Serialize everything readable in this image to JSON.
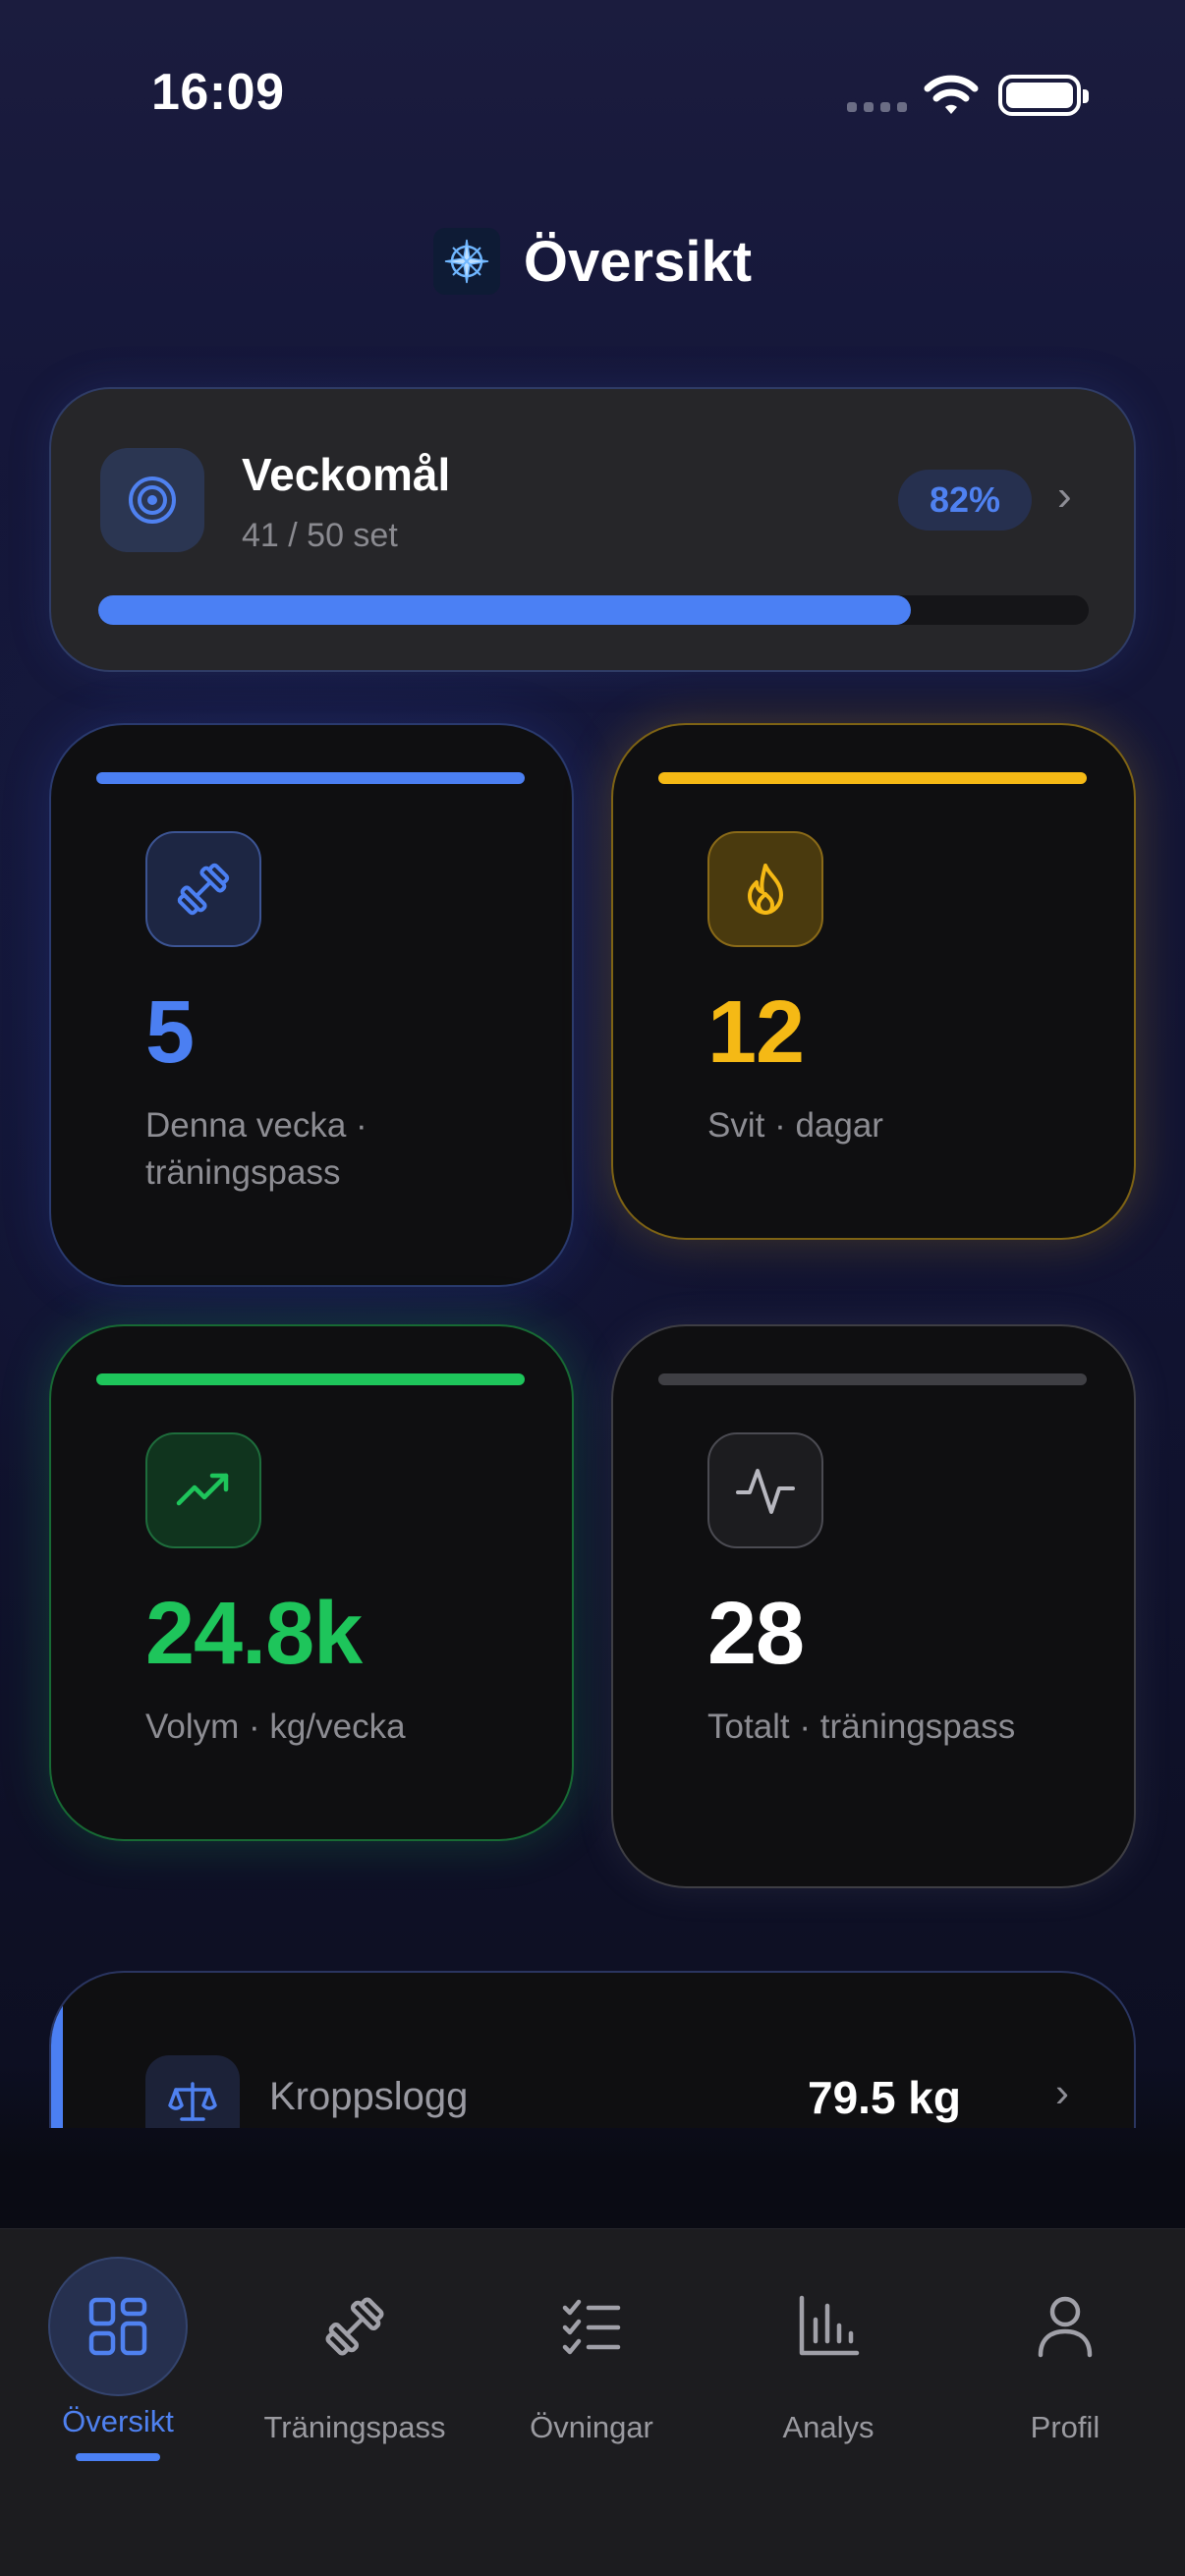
{
  "status_bar": {
    "time": "16:09"
  },
  "header": {
    "title": "Översikt",
    "logo_icon": "compass-icon"
  },
  "goal": {
    "title": "Veckomål",
    "subtitle": "41 / 50 set",
    "percent_label": "82%",
    "progress": 0.82
  },
  "stats": {
    "week": {
      "value": "5",
      "label": "Denna vecka · träningspass",
      "color": "#4b7ff2",
      "icon": "dumbbell-icon"
    },
    "streak": {
      "value": "12",
      "label": "Svit · dagar",
      "color": "#f5b915",
      "icon": "flame-icon"
    },
    "volume": {
      "value": "24.8k",
      "label": "Volym · kg/vecka",
      "color": "#1ec55b",
      "icon": "trending-up-icon"
    },
    "total": {
      "value": "28",
      "label": "Totalt · träningspass",
      "color": "#ffffff",
      "icon": "activity-icon"
    }
  },
  "body_log": {
    "label": "Kroppslogg",
    "value": "79.5 kg",
    "icon": "scale-icon"
  },
  "tabs": [
    {
      "label": "Översikt",
      "icon": "grid-icon",
      "active": true
    },
    {
      "label": "Träningspass",
      "icon": "dumbbell-icon",
      "active": false
    },
    {
      "label": "Övningar",
      "icon": "checklist-icon",
      "active": false
    },
    {
      "label": "Analys",
      "icon": "bar-chart-icon",
      "active": false
    },
    {
      "label": "Profil",
      "icon": "person-icon",
      "active": false
    }
  ]
}
